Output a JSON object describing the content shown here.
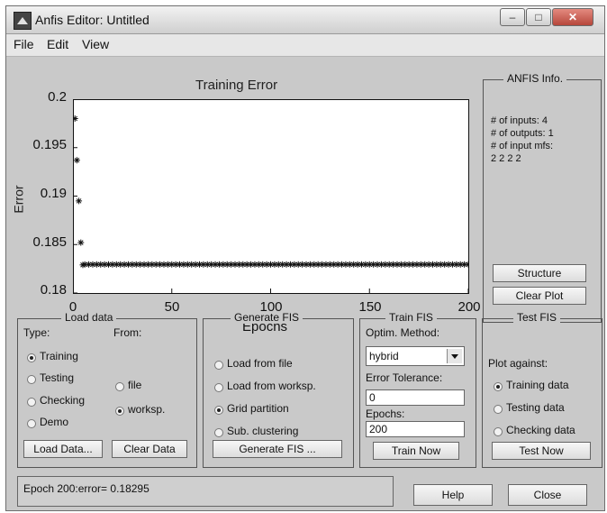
{
  "window": {
    "title": "Anfis Editor: Untitled"
  },
  "menu": {
    "items": [
      "File",
      "Edit",
      "View"
    ]
  },
  "chart_data": {
    "type": "scatter",
    "title": "Training Error",
    "xlabel": "Epochs",
    "ylabel": "Error",
    "xlim": [
      0,
      200
    ],
    "ylim": [
      0.18,
      0.2
    ],
    "xticks": [
      "0",
      "50",
      "100",
      "150",
      "200"
    ],
    "yticks": [
      "0.2",
      "0.195",
      "0.19",
      "0.185",
      "0.18"
    ],
    "marker": "asterisk",
    "grid": false,
    "series": [
      {
        "x": [
          1,
          2,
          3,
          4,
          5,
          6,
          8,
          10,
          12,
          14,
          16,
          18,
          20,
          22,
          24,
          26,
          28,
          30,
          32,
          34,
          36,
          38,
          40,
          42,
          44,
          46,
          48,
          50,
          52,
          54,
          56,
          58,
          60,
          62,
          64,
          66,
          68,
          70,
          72,
          74,
          76,
          78,
          80,
          82,
          84,
          86,
          88,
          90,
          92,
          94,
          96,
          98,
          100,
          102,
          104,
          106,
          108,
          110,
          112,
          114,
          116,
          118,
          120,
          122,
          124,
          126,
          128,
          130,
          132,
          134,
          136,
          138,
          140,
          142,
          144,
          146,
          148,
          150,
          152,
          154,
          156,
          158,
          160,
          162,
          164,
          166,
          168,
          170,
          172,
          174,
          176,
          178,
          180,
          182,
          184,
          186,
          188,
          190,
          192,
          194,
          196,
          198,
          200
        ],
        "y": [
          0.198,
          0.1937,
          0.1895,
          0.1852,
          0.1829,
          0.18295,
          0.18295,
          0.18295,
          0.18295,
          0.18295,
          0.18295,
          0.18295,
          0.18295,
          0.18295,
          0.18295,
          0.18295,
          0.18295,
          0.18295,
          0.18295,
          0.18295,
          0.18295,
          0.18295,
          0.18295,
          0.18295,
          0.18295,
          0.18295,
          0.18295,
          0.18295,
          0.18295,
          0.18295,
          0.18295,
          0.18295,
          0.18295,
          0.18295,
          0.18295,
          0.18295,
          0.18295,
          0.18295,
          0.18295,
          0.18295,
          0.18295,
          0.18295,
          0.18295,
          0.18295,
          0.18295,
          0.18295,
          0.18295,
          0.18295,
          0.18295,
          0.18295,
          0.18295,
          0.18295,
          0.18295,
          0.18295,
          0.18295,
          0.18295,
          0.18295,
          0.18295,
          0.18295,
          0.18295,
          0.18295,
          0.18295,
          0.18295,
          0.18295,
          0.18295,
          0.18295,
          0.18295,
          0.18295,
          0.18295,
          0.18295,
          0.18295,
          0.18295,
          0.18295,
          0.18295,
          0.18295,
          0.18295,
          0.18295,
          0.18295,
          0.18295,
          0.18295,
          0.18295,
          0.18295,
          0.18295,
          0.18295,
          0.18295,
          0.18295,
          0.18295,
          0.18295,
          0.18295,
          0.18295,
          0.18295,
          0.18295,
          0.18295,
          0.18295,
          0.18295,
          0.18295,
          0.18295,
          0.18295,
          0.18295,
          0.18295,
          0.18295,
          0.18295,
          0.18295
        ]
      }
    ]
  },
  "anfis_info": {
    "title": "ANFIS Info.",
    "lines": [
      "# of inputs: 4",
      "# of outputs: 1",
      "# of input mfs:",
      "2 2 2 2"
    ],
    "structure_button": "Structure",
    "clear_plot_button": "Clear Plot"
  },
  "load_data": {
    "title": "Load data",
    "type_label": "Type:",
    "from_label": "From:",
    "types": [
      "Training",
      "Testing",
      "Checking",
      "Demo"
    ],
    "types_selected": "Training",
    "sources": [
      "file",
      "worksp."
    ],
    "sources_selected": "worksp.",
    "load_button": "Load Data...",
    "clear_button": "Clear Data"
  },
  "generate_fis": {
    "title": "Generate FIS",
    "options": [
      "Load from file",
      "Load from worksp.",
      "Grid partition",
      "Sub. clustering"
    ],
    "selected": "Grid partition",
    "button": "Generate FIS ..."
  },
  "train_fis": {
    "title": "Train FIS",
    "method_label": "Optim. Method:",
    "method_value": "hybrid",
    "tolerance_label": "Error Tolerance:",
    "tolerance_value": "0",
    "epochs_label": "Epochs:",
    "epochs_value": "200",
    "button": "Train Now"
  },
  "test_fis": {
    "title": "Test FIS",
    "plot_against_label": "Plot against:",
    "options": [
      "Training data",
      "Testing data",
      "Checking data"
    ],
    "selected": "Training data",
    "button": "Test Now"
  },
  "status": {
    "text": "Epoch 200:error= 0.18295"
  },
  "footer": {
    "help_button": "Help",
    "close_button": "Close"
  },
  "colors": {
    "window_bg": "#c9c9c9",
    "plot_bg": "#ffffff",
    "marker": "#111111"
  }
}
